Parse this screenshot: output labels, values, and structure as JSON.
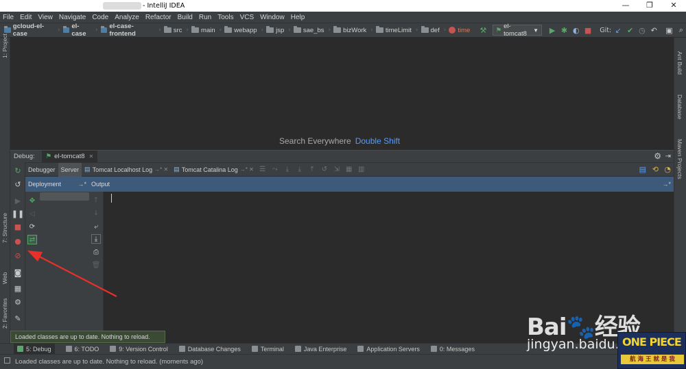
{
  "window": {
    "title": "- IntelliJ IDEA",
    "controls": {
      "minimize": "—",
      "maximize": "❐",
      "close": "✕"
    }
  },
  "menu": [
    "File",
    "Edit",
    "View",
    "Navigate",
    "Code",
    "Analyze",
    "Refactor",
    "Build",
    "Run",
    "Tools",
    "VCS",
    "Window",
    "Help"
  ],
  "breadcrumbs": [
    "gcloud-el-case",
    "el-case",
    "el-case-frontend",
    "src",
    "main",
    "webapp",
    "jsp",
    "sae_bs",
    "bizWork",
    "timeLimit",
    "def",
    "time"
  ],
  "toolbar": {
    "run_config": "el-tomcat8",
    "git_label": "Git:"
  },
  "editor": {
    "hint": "Search Everywhere",
    "shortcut": "Double Shift"
  },
  "left_tool_windows": [
    "1: Project",
    "7: Structure",
    "Web",
    "2: Favorites"
  ],
  "right_tool_windows": [
    "Ant Build",
    "Database",
    "Maven Projects"
  ],
  "debug": {
    "label": "Debug:",
    "session": "el-tomcat8",
    "tabs": [
      "Debugger",
      "Server",
      "Tomcat Localhost Log",
      "Tomcat Catalina Log"
    ],
    "deployment_header": "Deployment",
    "output_header": "Output"
  },
  "tooltip": "Loaded classes are up to date. Nothing to reload.",
  "bottom_tools": [
    {
      "label": "5: Debug",
      "icon": "bug-icon"
    },
    {
      "label": "6: TODO",
      "icon": "todo-icon"
    },
    {
      "label": "9: Version Control",
      "icon": "vcs-icon"
    },
    {
      "label": "Database Changes",
      "icon": "database-icon"
    },
    {
      "label": "Terminal",
      "icon": "terminal-icon"
    },
    {
      "label": "Java Enterprise",
      "icon": "java-ee-icon"
    },
    {
      "label": "Application Servers",
      "icon": "server-icon"
    },
    {
      "label": "0: Messages",
      "icon": "messages-icon"
    }
  ],
  "status": "Loaded classes are up to date. Nothing to reload. (moments ago)",
  "watermark": {
    "brand": "Bai",
    "brand2": "经验",
    "url": "jingyan.baidu.com",
    "logo_top": "ONE PIECE",
    "logo_bottom": "航 海 王 就 是 我"
  },
  "colors": {
    "accent_link": "#589df6",
    "run_green": "#59a869",
    "stop_red": "#c75450",
    "arrow_red": "#e8302a",
    "selection_blue": "#3d5a7a"
  }
}
